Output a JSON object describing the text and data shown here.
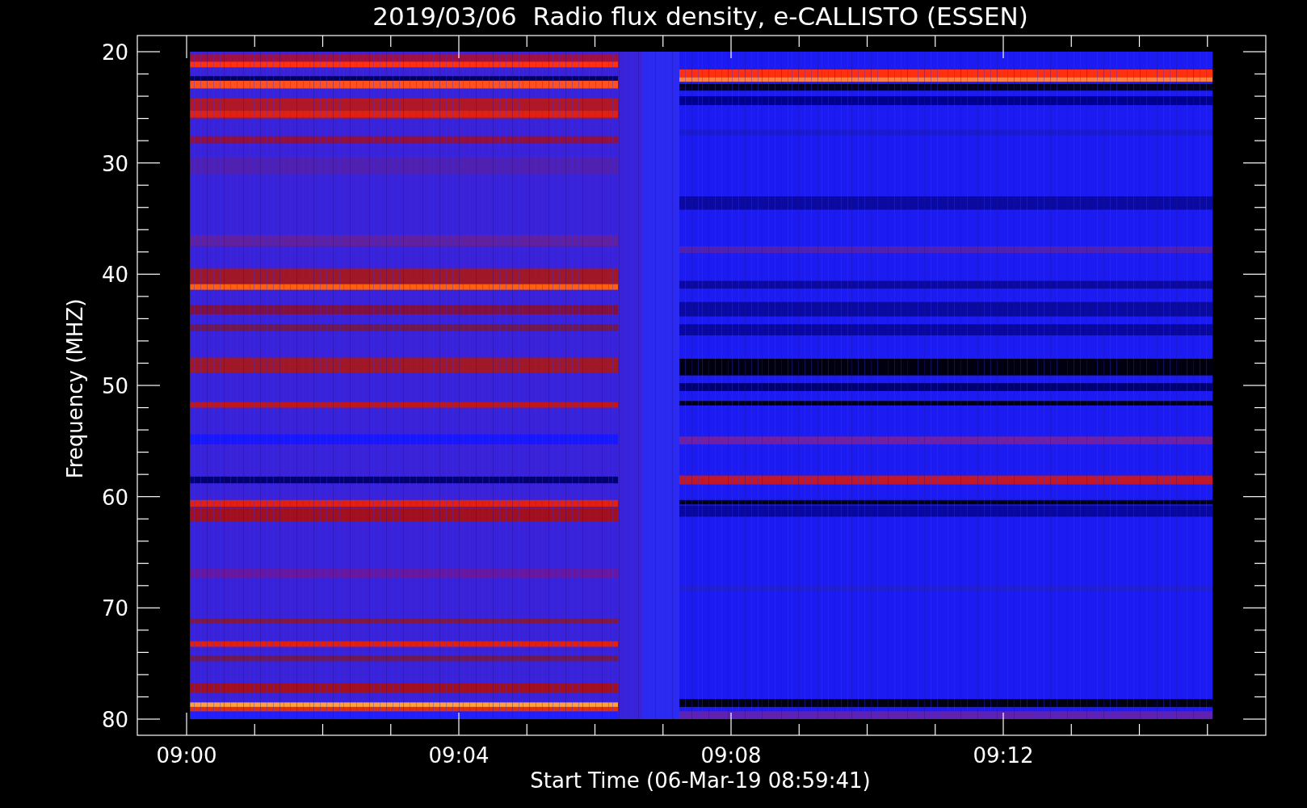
{
  "chart": {
    "title": "2019/03/06  Radio flux density, e-CALLISTO (ESSEN)",
    "xlabel": "Start Time (06-Mar-19 08:59:41)",
    "ylabel": "Frequency (MHZ)",
    "x_tick_labels": [
      "09:00",
      "09:04",
      "09:08",
      "09:12"
    ],
    "y_tick_labels": [
      "20",
      "30",
      "40",
      "50",
      "60",
      "70",
      "80"
    ]
  }
}
